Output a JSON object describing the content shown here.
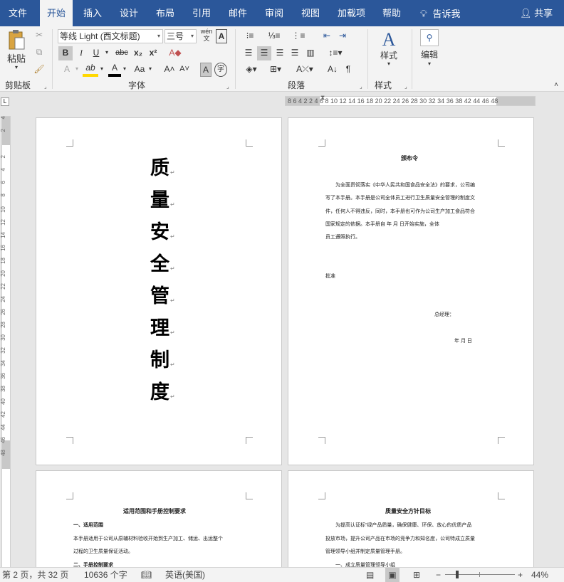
{
  "menu": {
    "tabs": [
      "文件",
      "开始",
      "插入",
      "设计",
      "布局",
      "引用",
      "邮件",
      "审阅",
      "视图",
      "加载项",
      "帮助"
    ],
    "active_tab": "开始",
    "tell_me": "告诉我",
    "share": "共享"
  },
  "ribbon": {
    "clipboard": {
      "paste_label": "粘贴",
      "group_label": "剪贴板"
    },
    "font": {
      "font_name": "等线 Light (西文标题)",
      "font_size": "三号",
      "group_label": "字体",
      "bold": "B",
      "italic": "I",
      "underline": "U",
      "strike": "abc",
      "sub": "x₂",
      "sup": "x²",
      "grow": "A˄",
      "shrink": "A˅",
      "case": "Aa",
      "phonetic": "wén",
      "highlight": "ab"
    },
    "paragraph": {
      "group_label": "段落"
    },
    "styles": {
      "label": "样式",
      "group_label": "样式"
    },
    "editing": {
      "label": "编辑"
    }
  },
  "ruler": {
    "horizontal_ticks": "8  6  4  2      2   4   6   8  10 12 14 16 18 20 22 24 26 28 30 32 34 36 38     42 44 46 48",
    "vertical_ticks": [
      "4",
      "2",
      "",
      "2",
      "4",
      "6",
      "8",
      "10",
      "12",
      "14",
      "16",
      "18",
      "20",
      "22",
      "24",
      "26",
      "28",
      "30",
      "32",
      "34",
      "36",
      "38",
      "40",
      "42",
      "44",
      "46",
      "48"
    ]
  },
  "pages": {
    "cover_title_chars": [
      "质",
      "量",
      "安",
      "全",
      "管",
      "理",
      "制",
      "度"
    ],
    "decree": {
      "title": "颁布令",
      "lines": [
        "为全面贯彻落实《中华人民共和国食品安全法》的要求，公司编",
        "写了本手册。本手册是公司全体员工进行卫生质量安全管理的制度文",
        "件，任何人不得违反，同时，本手册也可作为公司生产加工食品符合",
        "国家规定的依据。本手册自         年       月          日开始实施，全体",
        "员工遵照执行。"
      ],
      "attach": "批准",
      "signer": "总经理：",
      "date": "年      月      日"
    },
    "scope": {
      "title": "适用范围和手册控制要求",
      "h1": "一、适用范围",
      "p1": "本手册适用于公司从原辅材料验收开始到生产加工、储运、出运整个",
      "p2": "过程的卫生质量保证活动。",
      "h2": "二、手册控制要求"
    },
    "policy": {
      "title": "质量安全方针目标",
      "p1": "为提高认证标“绿产品质量，确保健康、环保、放心的优质产品",
      "p2": "投放市场，提升公司产品在市场的竞争力和知名度，公司特成立质量",
      "p3": "管理领导小组并制定质量管理手册。",
      "h1": "一、成立质量管理领导小组"
    }
  },
  "status": {
    "page_info": "第 2 页，共 32 页",
    "word_count": "10636 个字",
    "language": "英语(美国)",
    "zoom": "44%",
    "zoom_minus": "−",
    "zoom_plus": "+"
  }
}
